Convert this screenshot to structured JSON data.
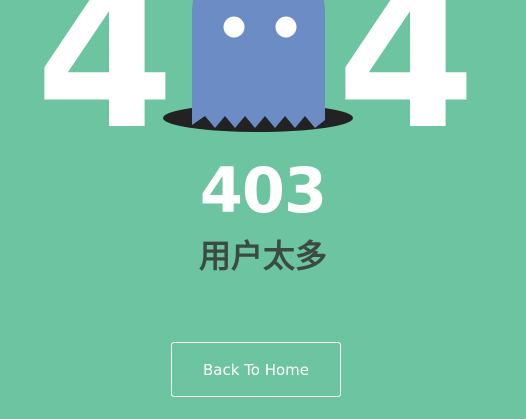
{
  "error_art": {
    "left_digit": "4",
    "right_digit": "4"
  },
  "status": {
    "code": "403",
    "message": "用户太多"
  },
  "actions": {
    "home_label": "Back To Home"
  },
  "colors": {
    "background": "#6cc4a1",
    "ghost": "#6b8cc4",
    "hole": "#222222",
    "text_primary": "#ffffff",
    "text_secondary": "#3c4a44"
  }
}
